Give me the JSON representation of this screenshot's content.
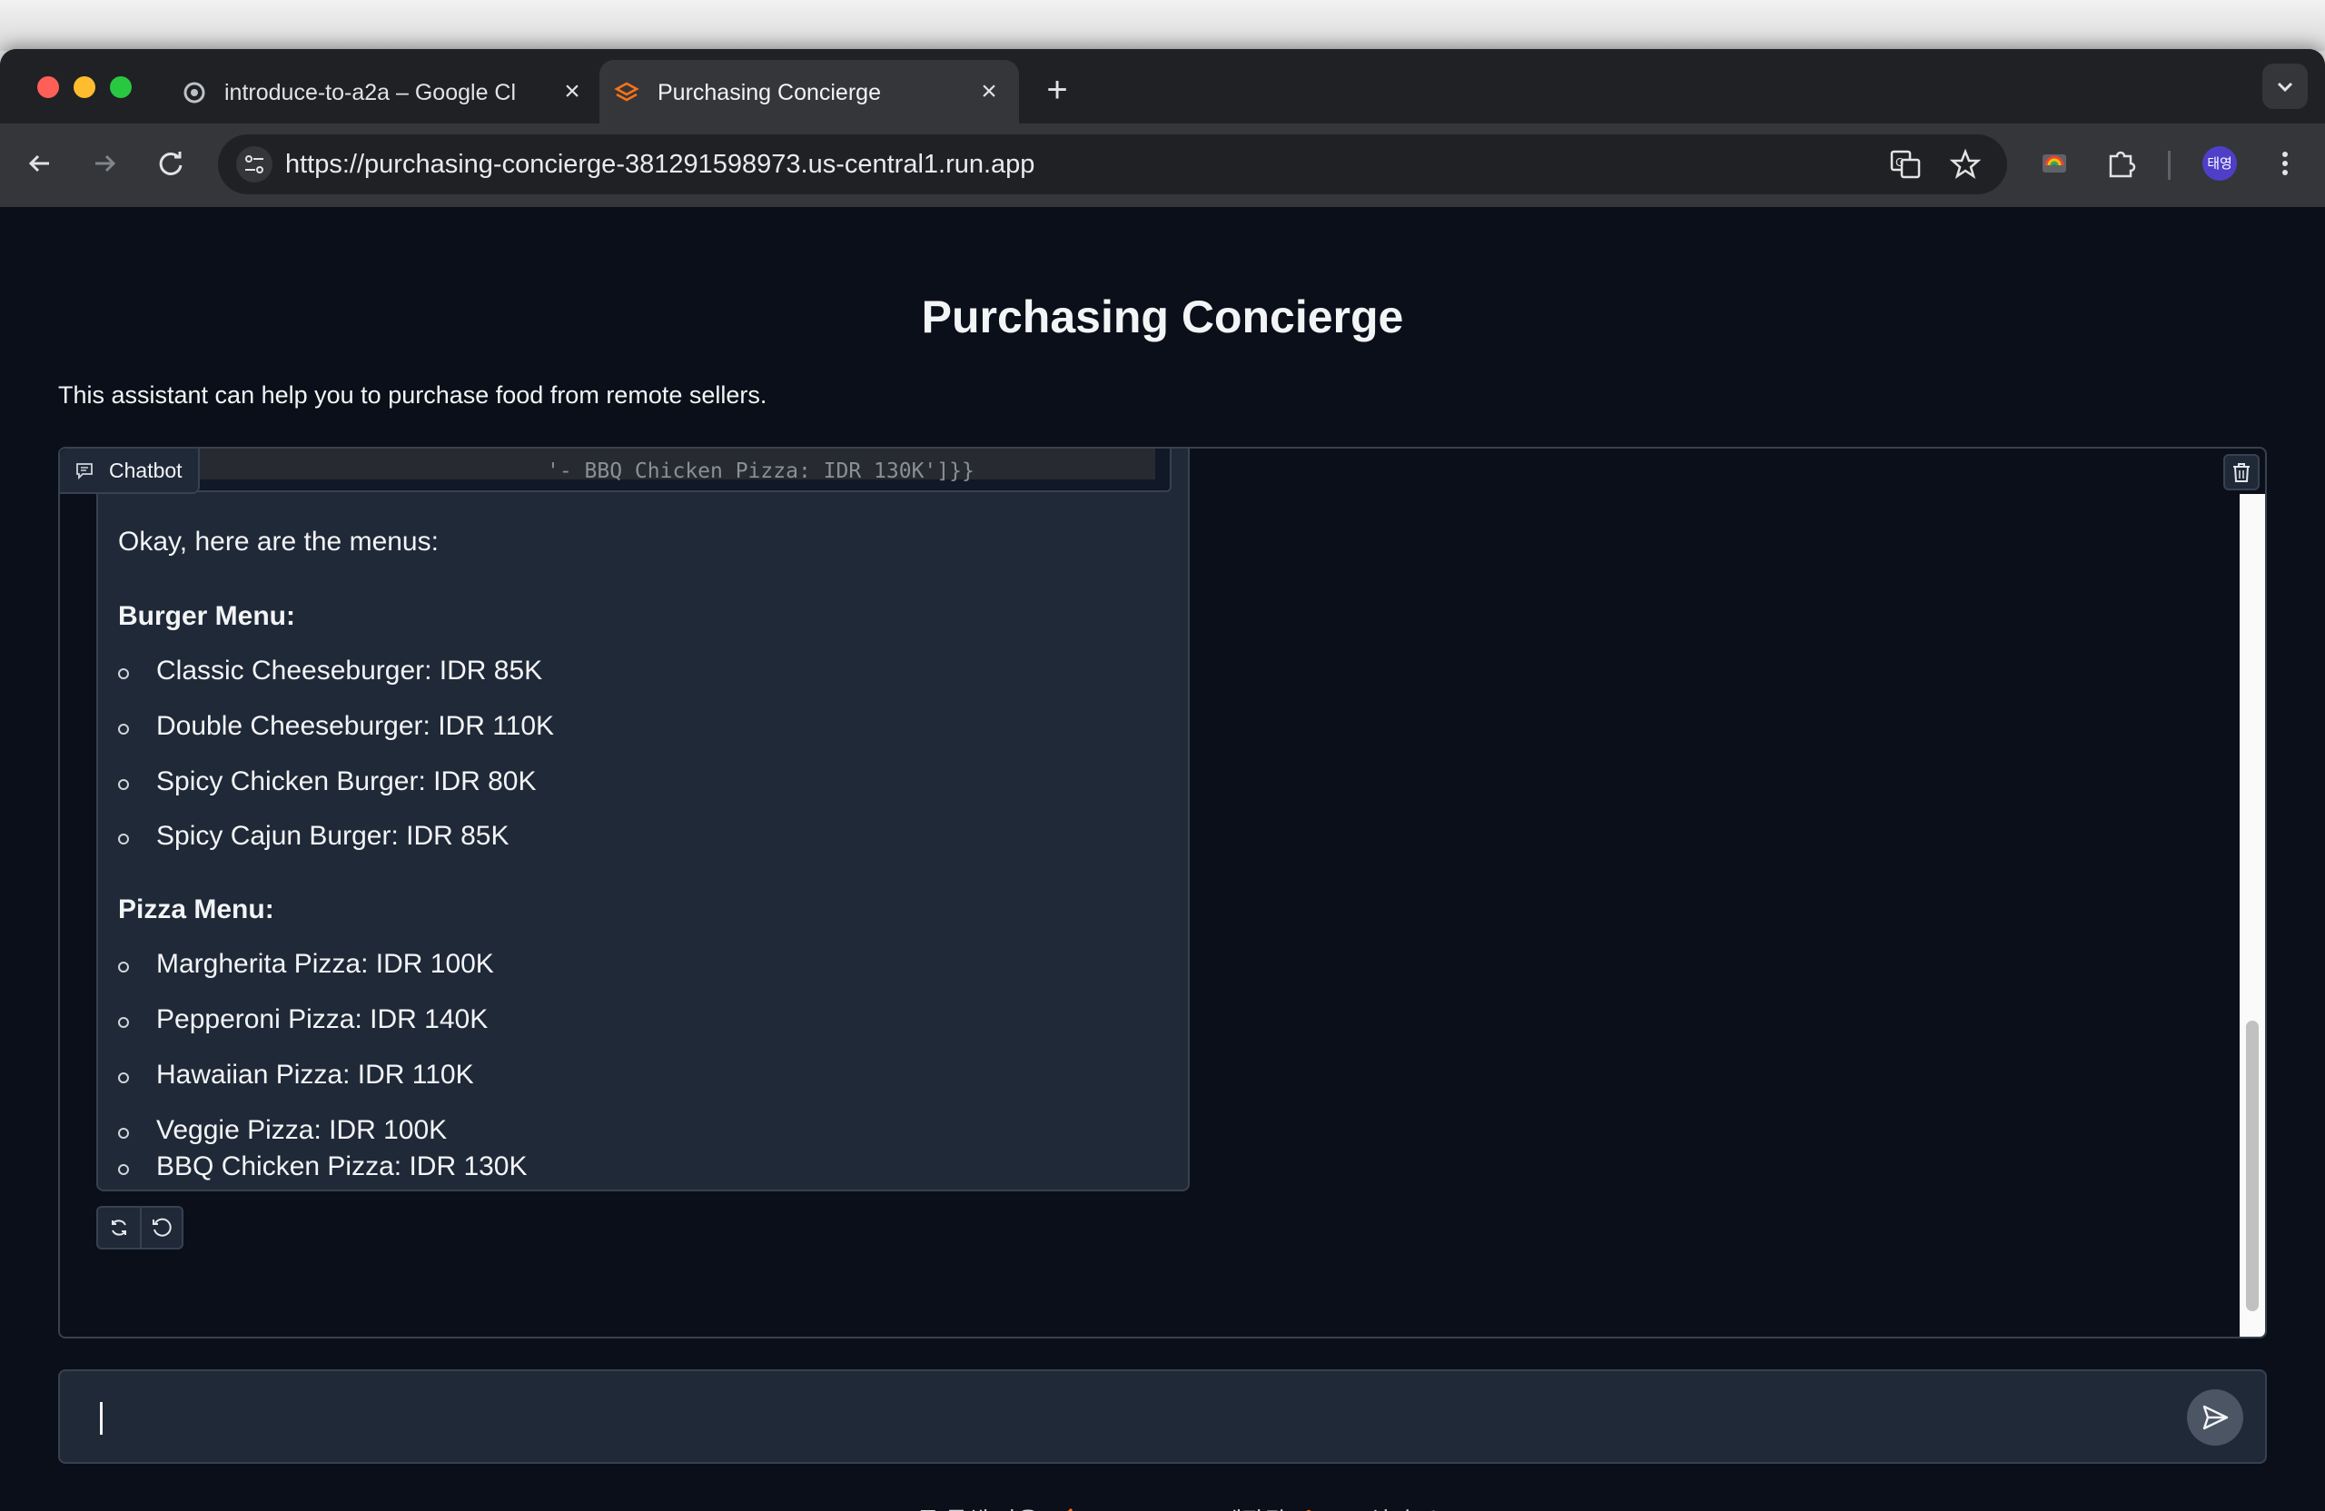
{
  "browser": {
    "tabs": [
      {
        "title": "introduce-to-a2a – Google Cl",
        "active": false,
        "favicon": "google-cloud-icon"
      },
      {
        "title": "Purchasing Concierge",
        "active": true,
        "favicon": "gradio-icon"
      }
    ],
    "url": "https://purchasing-concierge-381291598973.us-central1.run.app",
    "profile_initials": "태영"
  },
  "page": {
    "title": "Purchasing Concierge",
    "description": "This assistant can help you to purchase food from remote sellers."
  },
  "chatbot": {
    "label": "Chatbot",
    "code_snippet": "'- BBQ Chicken Pizza: IDR 130K']}}",
    "message": {
      "intro": "Okay, here are the menus:",
      "burger_heading": "Burger Menu:",
      "burger_items": [
        "Classic Cheeseburger: IDR 85K",
        "Double Cheeseburger: IDR 110K",
        "Spicy Chicken Burger: IDR 80K",
        "Spicy Cajun Burger: IDR 85K"
      ],
      "pizza_heading": "Pizza Menu:",
      "pizza_items": [
        "Margherita Pizza: IDR 100K",
        "Pepperoni Pizza: IDR 140K",
        "Hawaiian Pizza: IDR 110K",
        "Veggie Pizza: IDR 100K",
        "BBQ Chicken Pizza: IDR 130K"
      ]
    }
  },
  "input": {
    "value": ""
  },
  "footer": {
    "api_label": "API를 통해 사용",
    "gradio_label": "Gradio로 제작됨",
    "settings_label": "설정"
  },
  "colors": {
    "page_bg": "#0b0f19",
    "panel_bg": "#1f2937",
    "border": "#374151",
    "gradio_orange": "#f97316"
  }
}
